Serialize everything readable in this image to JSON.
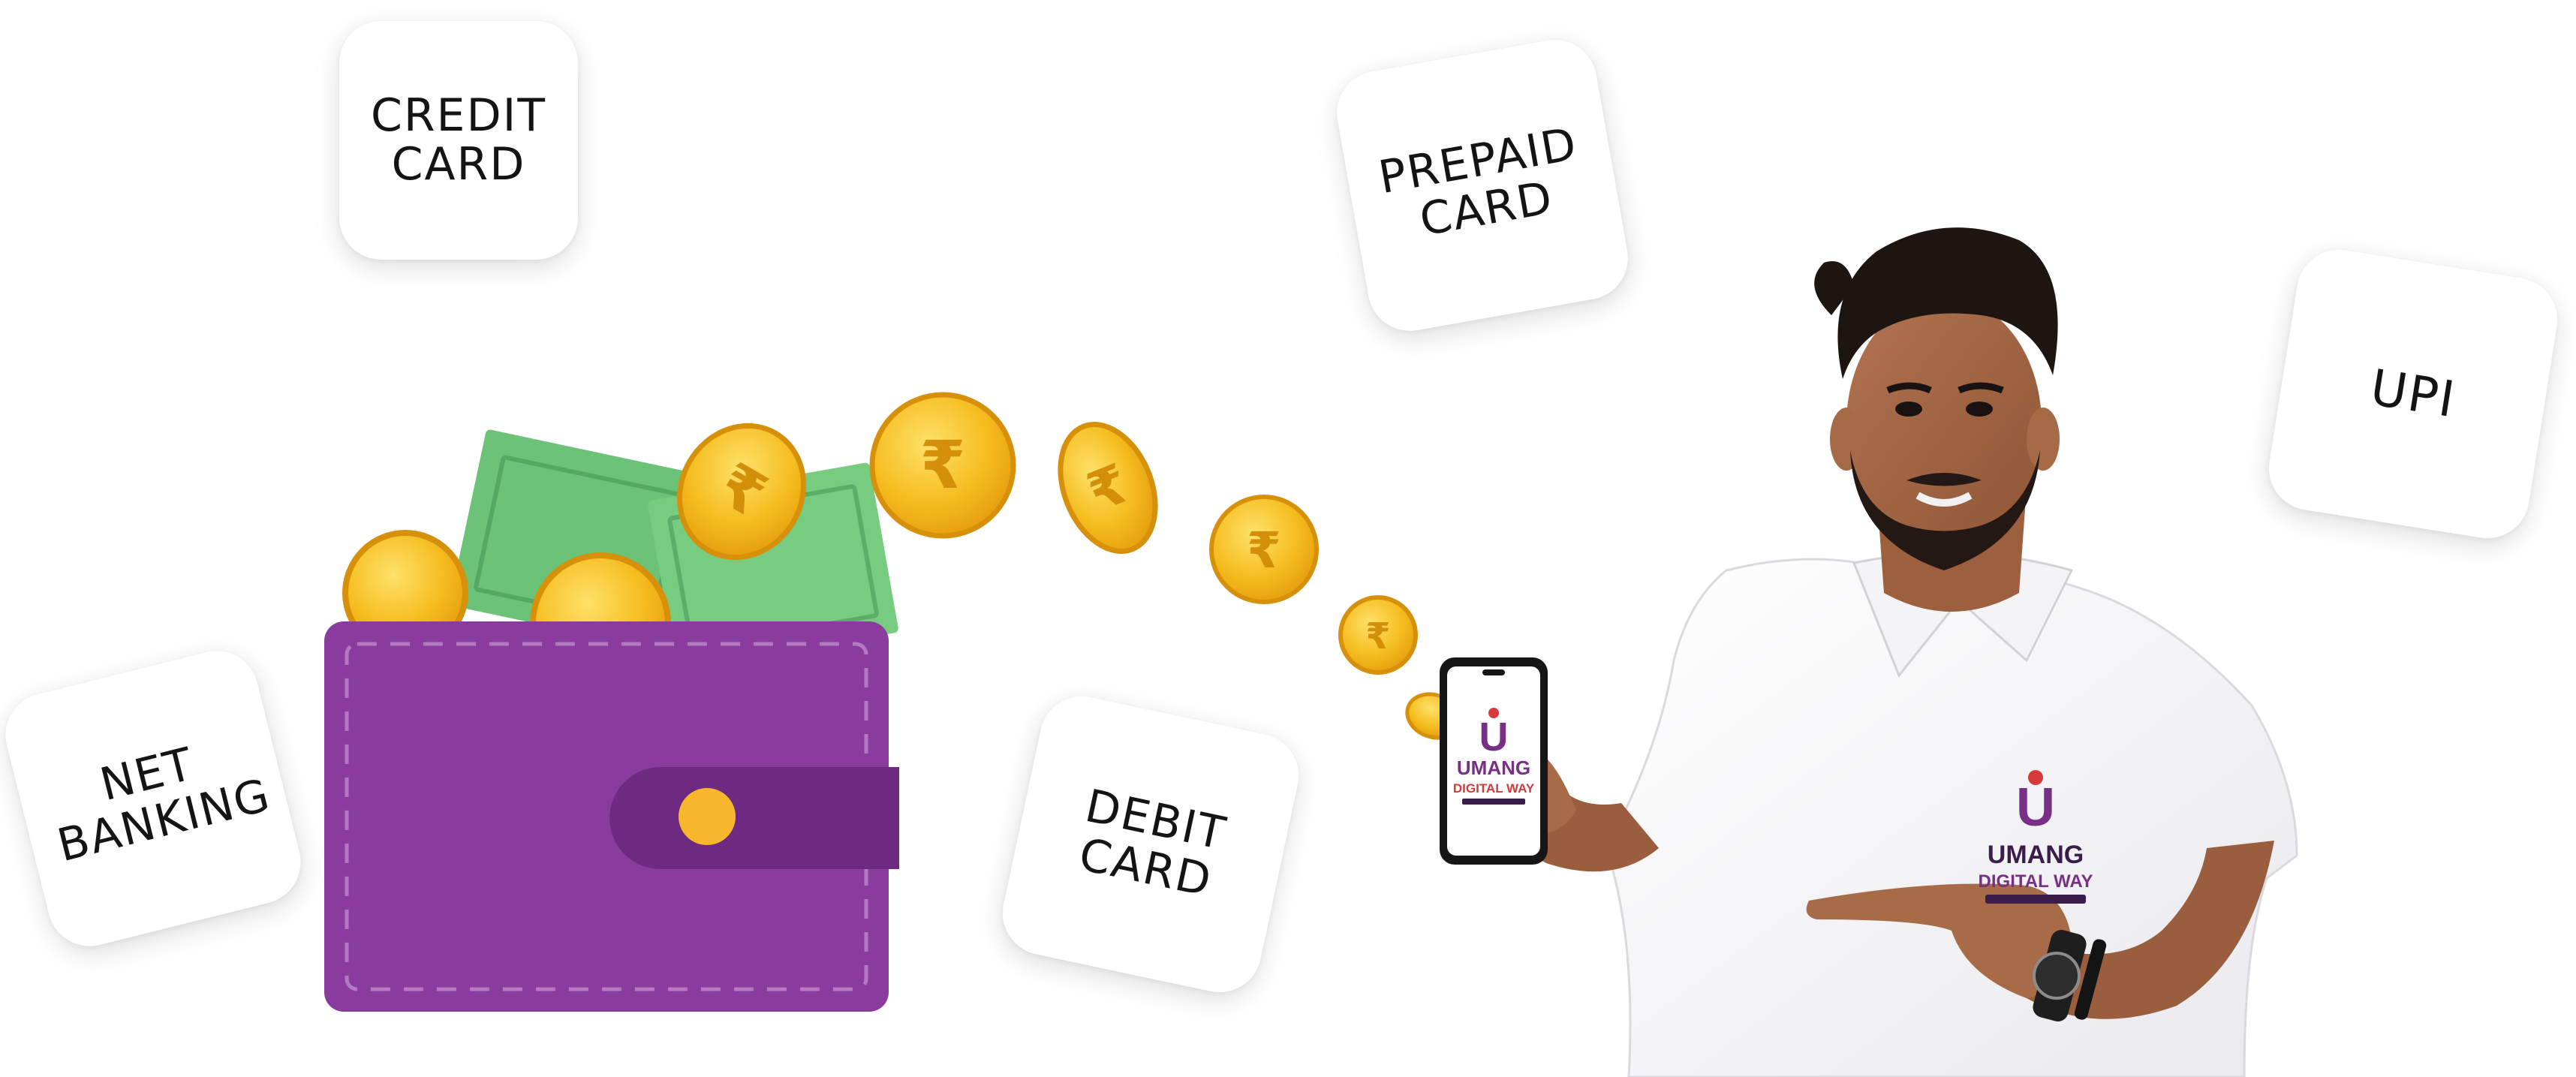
{
  "payment_methods": {
    "credit_card": "CREDIT CARD",
    "prepaid_card": "PREPAID CARD",
    "upi": "UPI",
    "net_banking": "NET BANKING",
    "debit_card": "DEBIT CARD"
  },
  "brand": {
    "name_line1": "UMANG",
    "name_line2": "DIGITAL WAY",
    "logo_letter": "U"
  },
  "coins": {
    "symbol": "₹"
  },
  "icons": [
    "wallet-icon",
    "banknote-icon",
    "rupee-coin-icon",
    "smartphone-icon"
  ],
  "colors": {
    "wallet": "#8a3b9e",
    "wallet_strap": "#6e2a80",
    "coin": "#f5bd1f",
    "cash": "#6cc276",
    "brand_purple": "#7a2f86",
    "brand_red": "#d63a3a"
  }
}
